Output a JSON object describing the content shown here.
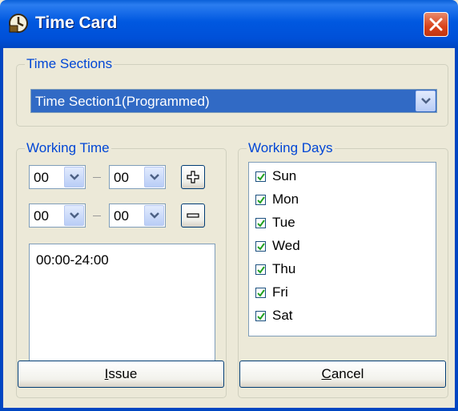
{
  "window": {
    "title": "Time Card",
    "icons": {
      "app": "clock-card-icon",
      "close": "close-icon"
    }
  },
  "time_sections": {
    "legend": "Time Sections",
    "selected": "Time Section1(Programmed)"
  },
  "working_time": {
    "legend": "Working Time",
    "start_hour": "00",
    "start_minute": "00",
    "end_hour": "00",
    "end_minute": "00",
    "add_icon": "plus-icon",
    "remove_icon": "minus-icon",
    "entries": [
      "00:00-24:00"
    ]
  },
  "working_days": {
    "legend": "Working Days",
    "days": [
      {
        "label": "Sun",
        "checked": true
      },
      {
        "label": "Mon",
        "checked": true
      },
      {
        "label": "Tue",
        "checked": true
      },
      {
        "label": "Wed",
        "checked": true
      },
      {
        "label": "Thu",
        "checked": true
      },
      {
        "label": "Fri",
        "checked": true
      },
      {
        "label": "Sat",
        "checked": true
      }
    ]
  },
  "buttons": {
    "issue_mnemonic": "I",
    "issue_rest": "ssue",
    "cancel_mnemonic": "C",
    "cancel_rest": "ancel"
  },
  "colors": {
    "titlebar": "#0058e0",
    "legend_text": "#0046d5",
    "selection": "#316ac5",
    "checkmark": "#21a121"
  }
}
